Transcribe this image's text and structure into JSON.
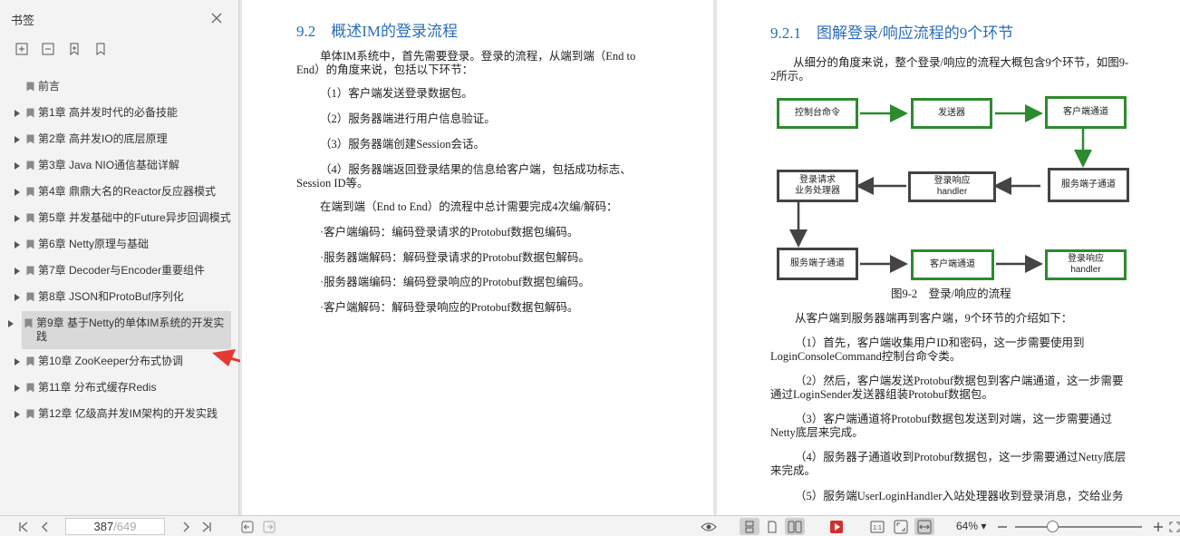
{
  "sidebar": {
    "title": "书签",
    "items": [
      {
        "label": "前言",
        "expandable": false
      },
      {
        "label": "第1章 高并发时代的必备技能",
        "expandable": true
      },
      {
        "label": "第2章 高并发IO的底层原理",
        "expandable": true
      },
      {
        "label": "第3章 Java NIO通信基础详解",
        "expandable": true
      },
      {
        "label": "第4章 鼎鼎大名的Reactor反应器模式",
        "expandable": true
      },
      {
        "label": "第5章 并发基础中的Future异步回调模式",
        "expandable": true
      },
      {
        "label": "第6章 Netty原理与基础",
        "expandable": true
      },
      {
        "label": "第7章 Decoder与Encoder重要组件",
        "expandable": true
      },
      {
        "label": "第8章 JSON和ProtoBuf序列化",
        "expandable": true
      },
      {
        "label": "第9章 基于Netty的单体IM系统的开发实践",
        "expandable": true,
        "selected": true
      },
      {
        "label": "第10章 ZooKeeper分布式协调",
        "expandable": true
      },
      {
        "label": "第11章 分布式缓存Redis",
        "expandable": true
      },
      {
        "label": "第12章 亿级高并发IM架构的开发实践",
        "expandable": true
      }
    ]
  },
  "left_page": {
    "heading": "9.2　概述IM的登录流程",
    "paragraphs": [
      "单体IM系统中，首先需要登录。登录的流程，从端到端（End to End）的角度来说，包括以下环节：",
      "（1）客户端发送登录数据包。",
      "（2）服务器端进行用户信息验证。",
      "（3）服务器端创建Session会话。",
      "（4）服务器端返回登录结果的信息给客户端，包括成功标志、Session ID等。",
      "在端到端（End to End）的流程中总计需要完成4次编/解码：",
      "·客户端编码：编码登录请求的Protobuf数据包编码。",
      "·服务器端解码：解码登录请求的Protobuf数据包解码。",
      "·服务器端编码：编码登录响应的Protobuf数据包编码。",
      "·客户端解码：解码登录响应的Protobuf数据包解码。"
    ]
  },
  "right_page": {
    "heading": "9.2.1　图解登录/响应流程的9个环节",
    "intro": "从细分的角度来说，整个登录/响应的流程大概包含9个环节，如图9-2所示。",
    "diagram": {
      "boxes": [
        "控制台命令",
        "发送器",
        "客户端通道",
        "登录请求\n业务处理器",
        "登录响应\nhandler",
        "服务端子通道",
        "服务端子通道",
        "客户端通道",
        "登录响应\nhandler"
      ],
      "caption": "图9-2　登录/响应的流程"
    },
    "paragraphs": [
      "从客户端到服务器端再到客户端，9个环节的介绍如下：",
      "（1）首先，客户端收集用户ID和密码，这一步需要使用到LoginConsoleCommand控制台命令类。",
      "（2）然后，客户端发送Protobuf数据包到客户端通道，这一步需要通过LoginSender发送器组装Protobuf数据包。",
      "（3）客户端通道将Protobuf数据包发送到对端，这一步需要通过Netty底层来完成。",
      "（4）服务器子通道收到Protobuf数据包，这一步需要通过Netty底层来完成。",
      "（5）服务端UserLoginHandler入站处理器收到登录消息，交给业务"
    ]
  },
  "bottombar": {
    "current_page": "387",
    "total_pages": "/649",
    "zoom": "64%",
    "zoom_fraction": 0.3
  }
}
